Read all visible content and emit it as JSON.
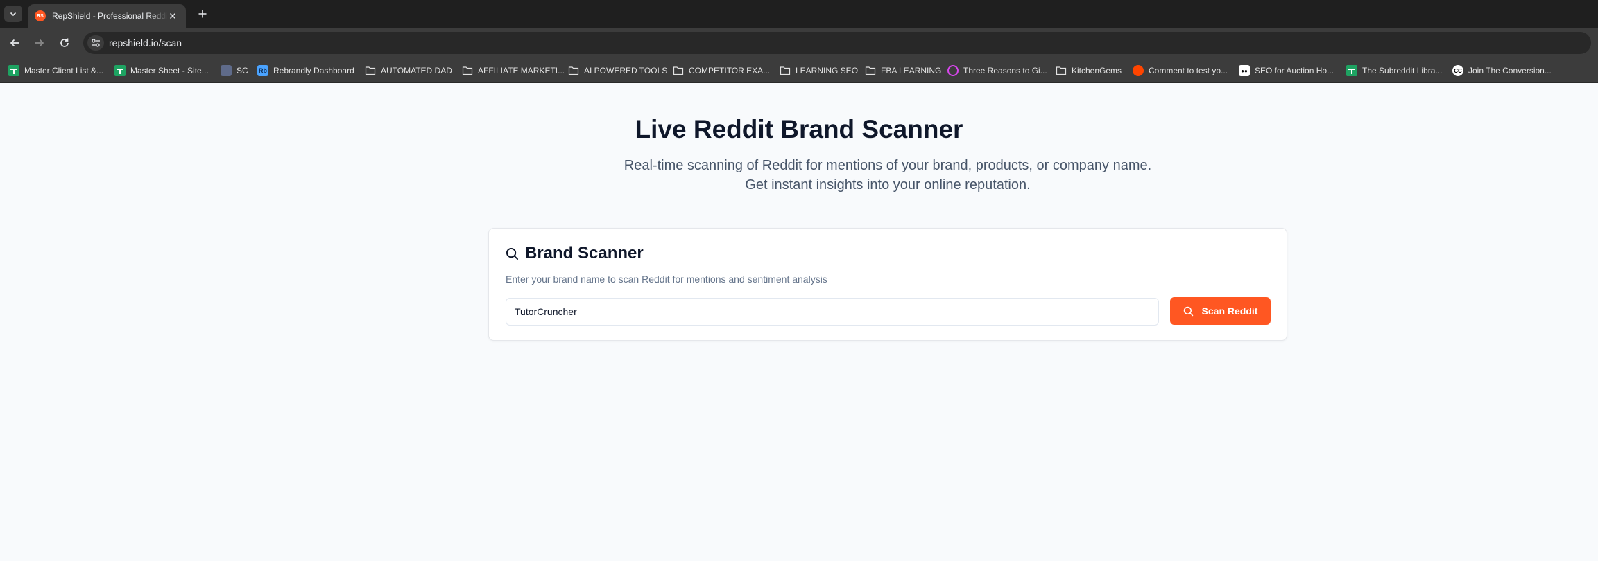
{
  "browser": {
    "tab": {
      "title": "RepShield - Professional Reddit Reputation",
      "favicon_text": "RS"
    },
    "url": "repshield.io/scan",
    "bookmarks": [
      {
        "label": "Master Client List &...",
        "icon": "sheets-icon"
      },
      {
        "label": "Master Sheet - Site...",
        "icon": "sheets-icon"
      },
      {
        "label": "SC",
        "icon": "sc-icon"
      },
      {
        "label": "Rebrandly Dashboard",
        "icon": "rebrandly-icon"
      },
      {
        "label": "AUTOMATED DAD",
        "icon": "folder-icon"
      },
      {
        "label": "AFFILIATE MARKETI...",
        "icon": "folder-icon"
      },
      {
        "label": "AI POWERED TOOLS",
        "icon": "folder-icon"
      },
      {
        "label": "COMPETITOR EXA...",
        "icon": "folder-icon"
      },
      {
        "label": "LEARNING SEO",
        "icon": "folder-icon"
      },
      {
        "label": "FBA LEARNING",
        "icon": "folder-icon"
      },
      {
        "label": "Three Reasons to Gi...",
        "icon": "site-icon"
      },
      {
        "label": "KitchenGems",
        "icon": "folder-icon"
      },
      {
        "label": "Comment to test yo...",
        "icon": "reddit-icon"
      },
      {
        "label": "SEO for Auction Ho...",
        "icon": "medium-icon"
      },
      {
        "label": "The Subreddit Libra...",
        "icon": "sheets-icon"
      },
      {
        "label": "Join The Conversion...",
        "icon": "cc-icon"
      }
    ]
  },
  "hero": {
    "title": "Live Reddit Brand Scanner",
    "subtitle": "Real-time scanning of Reddit for mentions of your brand, products, or company name. Get instant insights into your online reputation."
  },
  "scanner": {
    "title": "Brand Scanner",
    "description": "Enter your brand name to scan Reddit for mentions and sentiment analysis",
    "input_value": "TutorCruncher",
    "button_label": "Scan Reddit"
  },
  "colors": {
    "accent": "#ff5722",
    "heading": "#0f172a",
    "muted": "#64748b",
    "page_bg": "#f8fafc"
  }
}
